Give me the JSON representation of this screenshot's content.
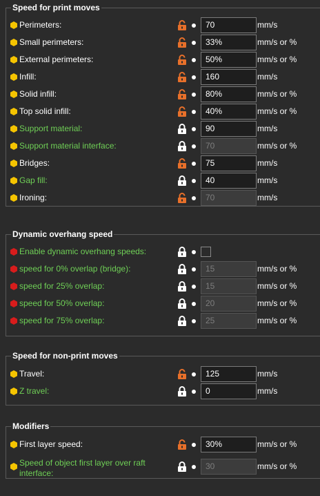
{
  "colors": {
    "background": "#2b2b2b",
    "simple_bullet": "#f5c400",
    "expert_bullet": "#d81c1c",
    "advanced_label": "#6fcf56",
    "unlocked_icon": "#e8702a",
    "locked_icon": "#ffffff"
  },
  "groups": [
    {
      "title": "Speed for print moves",
      "rows": [
        {
          "label": "Perimeters:",
          "mode": "simple",
          "lock": "unlocked",
          "value": "70",
          "disabled": false,
          "unit": "mm/s"
        },
        {
          "label": "Small perimeters:",
          "mode": "simple",
          "lock": "unlocked",
          "value": "33%",
          "disabled": false,
          "unit": "mm/s or %"
        },
        {
          "label": "External perimeters:",
          "mode": "simple",
          "lock": "unlocked",
          "value": "50%",
          "disabled": false,
          "unit": "mm/s or %"
        },
        {
          "label": "Infill:",
          "mode": "simple",
          "lock": "unlocked",
          "value": "160",
          "disabled": false,
          "unit": "mm/s"
        },
        {
          "label": "Solid infill:",
          "mode": "simple",
          "lock": "unlocked",
          "value": "80%",
          "disabled": false,
          "unit": "mm/s or %"
        },
        {
          "label": "Top solid infill:",
          "mode": "simple",
          "lock": "unlocked",
          "value": "40%",
          "disabled": false,
          "unit": "mm/s or %"
        },
        {
          "label": "Support material:",
          "mode": "advanced",
          "lock": "locked",
          "value": "90",
          "disabled": false,
          "unit": "mm/s"
        },
        {
          "label": "Support material interface:",
          "mode": "advanced",
          "lock": "locked",
          "value": "70",
          "disabled": true,
          "unit": "mm/s or %"
        },
        {
          "label": "Bridges:",
          "mode": "simple",
          "lock": "unlocked",
          "value": "75",
          "disabled": false,
          "unit": "mm/s"
        },
        {
          "label": "Gap fill:",
          "mode": "advanced",
          "lock": "locked",
          "value": "40",
          "disabled": false,
          "unit": "mm/s"
        },
        {
          "label": "Ironing:",
          "mode": "simple",
          "lock": "unlocked",
          "value": "70",
          "disabled": true,
          "unit": "mm/s"
        }
      ]
    },
    {
      "title": "Dynamic overhang speed",
      "rows": [
        {
          "label": "Enable dynamic overhang speeds:",
          "mode": "expert",
          "lock": "locked",
          "checkbox": true,
          "checked": false
        },
        {
          "label": "speed for 0% overlap (bridge):",
          "mode": "expert",
          "lock": "locked",
          "value": "15",
          "disabled": true,
          "unit": "mm/s or %"
        },
        {
          "label": "speed for 25% overlap:",
          "mode": "expert",
          "lock": "locked",
          "value": "15",
          "disabled": true,
          "unit": "mm/s or %"
        },
        {
          "label": "speed for 50% overlap:",
          "mode": "expert",
          "lock": "locked",
          "value": "20",
          "disabled": true,
          "unit": "mm/s or %"
        },
        {
          "label": "speed for 75% overlap:",
          "mode": "expert",
          "lock": "locked",
          "value": "25",
          "disabled": true,
          "unit": "mm/s or %"
        }
      ]
    },
    {
      "title": "Speed for non-print moves",
      "rows": [
        {
          "label": "Travel:",
          "mode": "simple",
          "lock": "unlocked",
          "value": "125",
          "disabled": false,
          "unit": "mm/s"
        },
        {
          "label": "Z travel:",
          "mode": "advanced",
          "lock": "locked",
          "value": "0",
          "disabled": false,
          "unit": "mm/s"
        }
      ]
    },
    {
      "title": "Modifiers",
      "rows": [
        {
          "label": "First layer speed:",
          "mode": "simple",
          "lock": "unlocked",
          "value": "30%",
          "disabled": false,
          "unit": "mm/s or %"
        },
        {
          "label": "Speed of object first layer over raft interface:",
          "mode": "advanced",
          "lock": "locked",
          "value": "30",
          "disabled": true,
          "unit": "mm/s or %",
          "two_line": true
        }
      ]
    }
  ]
}
